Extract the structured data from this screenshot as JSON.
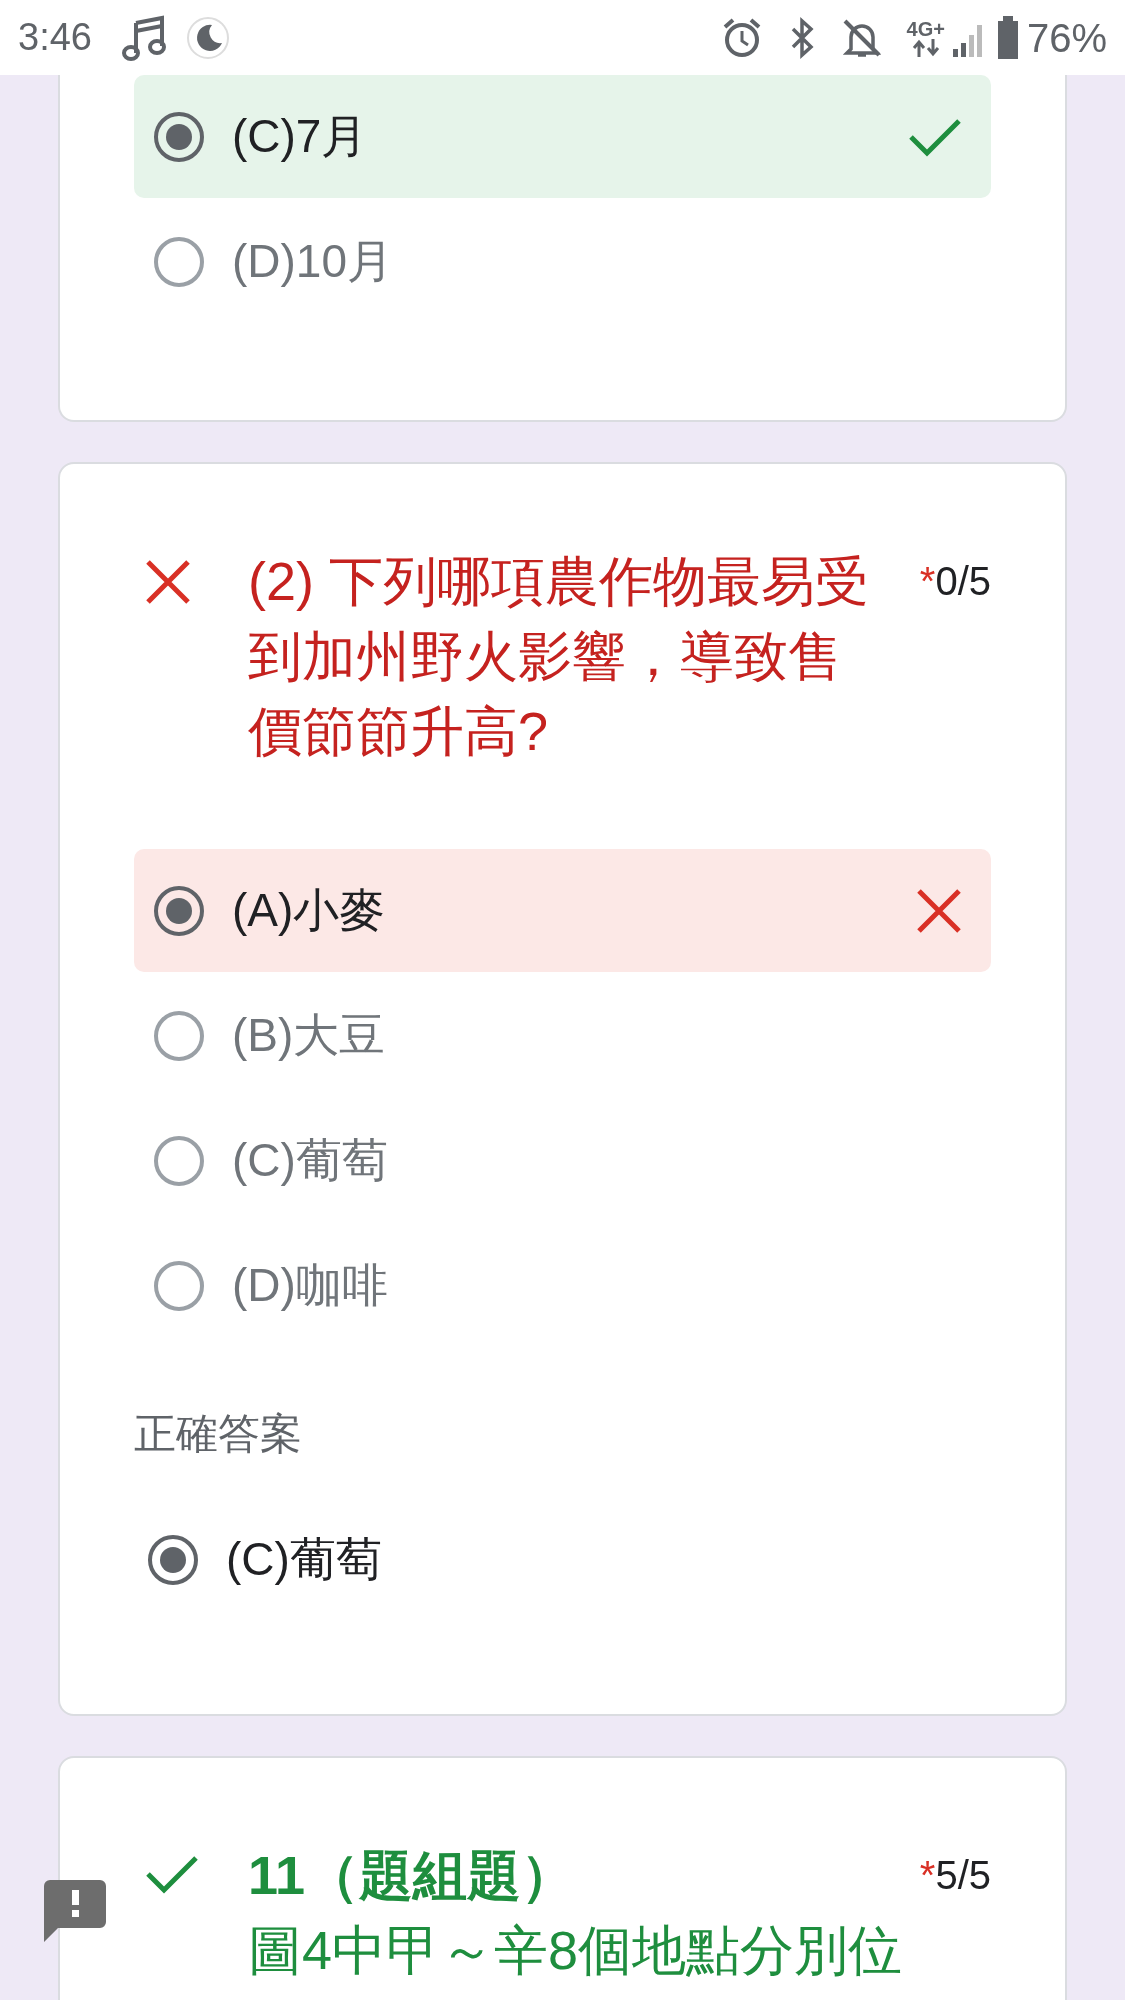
{
  "status_bar": {
    "time": "3:46",
    "network": "4G+",
    "battery": "76%"
  },
  "cards": [
    {
      "kind": "options",
      "options": [
        {
          "label": "(C)7月",
          "selected": true,
          "graded": true,
          "correct": true
        },
        {
          "label": "(D)10月",
          "selected": false,
          "graded": false
        }
      ]
    },
    {
      "kind": "question",
      "correct": false,
      "title": "(2) 下列哪項農作物最易受到加州野火影響，導致售價節節升高?",
      "required_mark": "*",
      "score": "0/5",
      "options": [
        {
          "label": "(A)小麥",
          "selected": true,
          "graded": true,
          "correct": false
        },
        {
          "label": "(B)大豆",
          "selected": false,
          "graded": false
        },
        {
          "label": "(C)葡萄",
          "selected": false,
          "graded": false
        },
        {
          "label": "(D)咖啡",
          "selected": false,
          "graded": false
        }
      ],
      "correct_answer": {
        "heading": "正確答案",
        "options": [
          {
            "label": "(C)葡萄",
            "selected": true
          }
        ]
      }
    },
    {
      "kind": "question",
      "correct": true,
      "title": "11（題組題）",
      "body": "圖4中甲～辛8個地點分別位",
      "required_mark": "*",
      "score": "5/5"
    }
  ]
}
